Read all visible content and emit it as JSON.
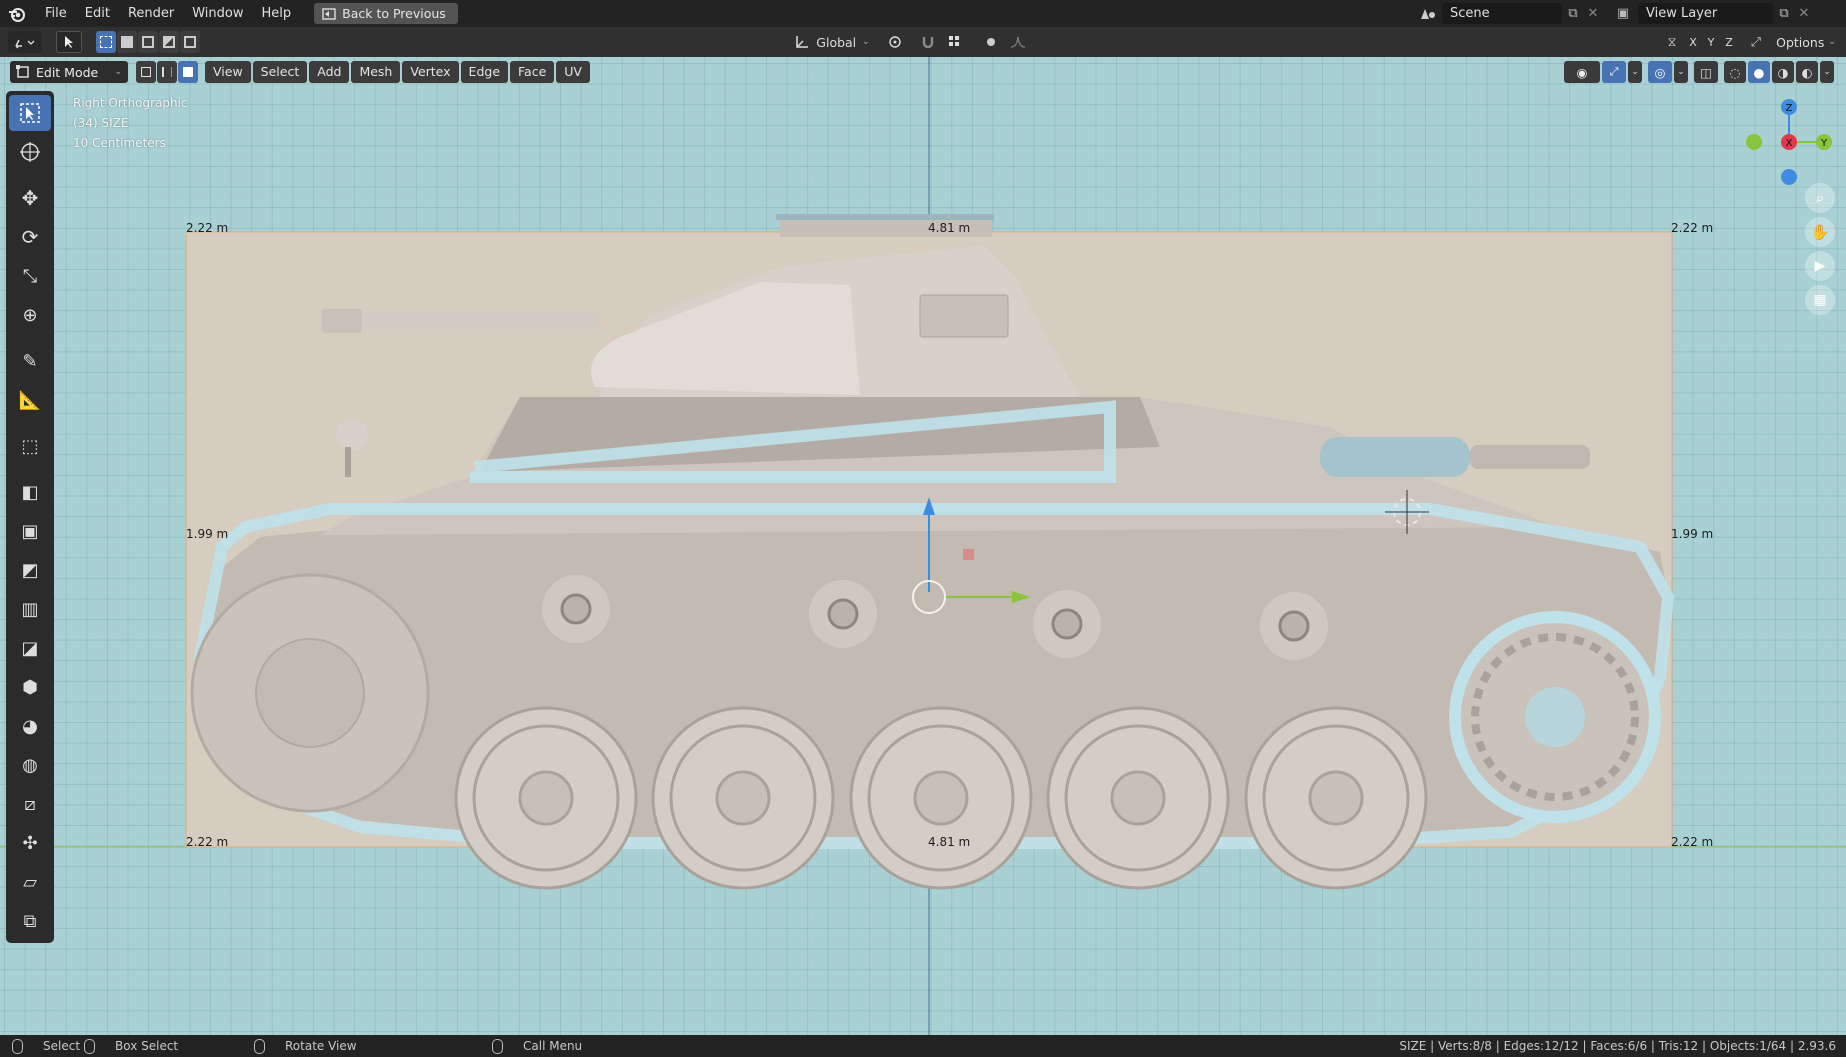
{
  "menubar": {
    "items": [
      "File",
      "Edit",
      "Render",
      "Window",
      "Help"
    ],
    "back_button": "Back to Previous",
    "scene_label": "Scene",
    "view_layer_label": "View Layer"
  },
  "header": {
    "transform_orientation": "Global",
    "axes": [
      "X",
      "Y",
      "Z"
    ],
    "options_label": "Options"
  },
  "viewport_header": {
    "mode": "Edit Mode",
    "menus": [
      "View",
      "Select",
      "Add",
      "Mesh",
      "Vertex",
      "Edge",
      "Face",
      "UV"
    ]
  },
  "viewport": {
    "view_name": "Right Orthographic",
    "object_label": "(34) SIZE",
    "grid_scale": "10 Centimeters",
    "dimensions": {
      "top_left": "2.22 m",
      "top_center": "4.81 m",
      "top_right": "2.22 m",
      "mid_left": "1.99 m",
      "mid_right": "1.99 m",
      "bottom_left": "2.22 m",
      "bottom_center": "4.81 m",
      "bottom_right": "2.22 m"
    },
    "gizmo": {
      "x": "X",
      "y": "Y",
      "z": "Z"
    }
  },
  "statusbar": {
    "select": "Select",
    "box_select": "Box Select",
    "rotate_view": "Rotate View",
    "call_menu": "Call Menu",
    "stats": "SIZE | Verts:8/8 | Edges:12/12 | Faces:6/6 | Tris:12 | Objects:1/64 | 2.93.6"
  },
  "colors": {
    "viewport_bg": "#a9d1d4",
    "accent": "#4772b3",
    "selection_outline": "#bfe1ea",
    "axis_x": "#e2374c",
    "axis_y": "#8ac43c",
    "axis_z": "#3d8ce0"
  }
}
